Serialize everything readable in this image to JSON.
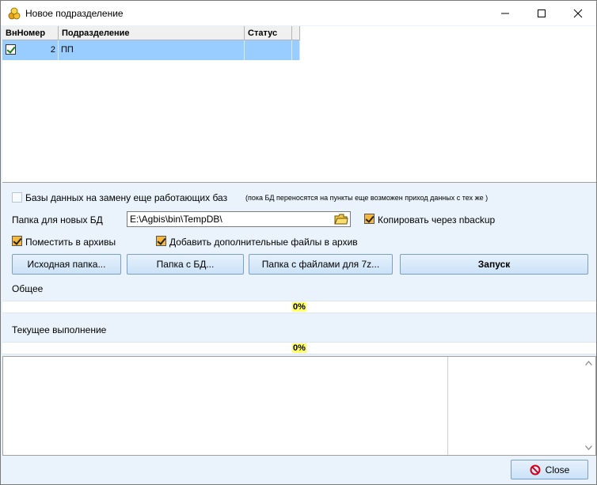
{
  "window": {
    "title": "Новое подразделение"
  },
  "grid": {
    "columns": [
      "ВнНомер",
      "Подразделение",
      "Статус"
    ],
    "rows": [
      {
        "checked": true,
        "num": "2",
        "name": "ПП",
        "status": ""
      }
    ]
  },
  "options": {
    "replace_db_label": "Базы данных на замену еще работающих баз",
    "replace_db_note": "(пока БД переносятся на пункты еще возможен приход данных с тех же )",
    "replace_db_checked": false,
    "new_db_folder_label": "Папка для новых БД",
    "new_db_folder_value": "E:\\Agbis\\bin\\TempDB\\",
    "nbackup_label": "Копировать через nbackup",
    "nbackup_checked": true,
    "archive_label": "Поместить в архивы",
    "archive_checked": true,
    "extra_files_label": "Добавить дополнительные файлы в архив",
    "extra_files_checked": true
  },
  "buttons": {
    "source_folder": "Исходная папка...",
    "db_folder": "Папка с БД...",
    "seven_z_folder": "Папка с файлами для 7z...",
    "start": "Запуск",
    "close": "Close"
  },
  "progress": {
    "overall_label": "Общее",
    "overall_value": "0%",
    "current_label": "Текущее выполнение",
    "current_value": "0%"
  },
  "colors": {
    "selected_row": "#99ccff",
    "panel_bg": "#eaf3fb",
    "percent_highlight": "#ffff66"
  },
  "icons": [
    "app-icon",
    "minimize-icon",
    "maximize-icon",
    "close-icon",
    "folder-open-icon",
    "no-entry-icon",
    "scroll-up-icon",
    "scroll-down-icon"
  ]
}
